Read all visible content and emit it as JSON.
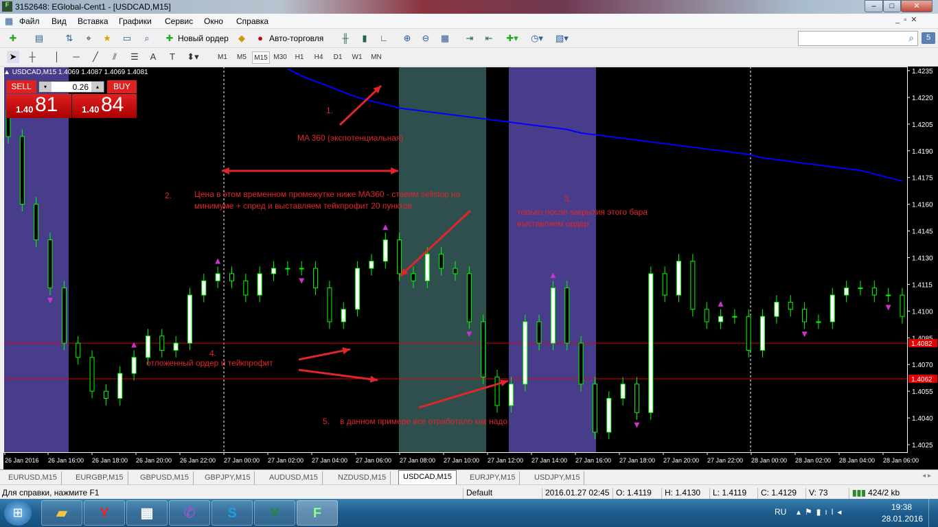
{
  "window": {
    "title": "3152648: EGlobal-Cent1 - [USDCAD,M15]",
    "controls": [
      "–",
      "□",
      "✕"
    ]
  },
  "menu": [
    "Файл",
    "Вид",
    "Вставка",
    "Графики",
    "Сервис",
    "Окно",
    "Справка"
  ],
  "toolbar": {
    "new_order": "Новый ордер",
    "auto_trading": "Авто-торговля",
    "notifications_count": "5",
    "search_placeholder": ""
  },
  "timeframes": [
    "M1",
    "M5",
    "M15",
    "M30",
    "H1",
    "H4",
    "D1",
    "W1",
    "MN"
  ],
  "active_timeframe": "M15",
  "chart": {
    "header": "USDCAD,M15  1.4069 1.4087 1.4069 1.4081",
    "one_click": {
      "sell": "SELL",
      "buy": "BUY",
      "lot": "0.26",
      "bid_prefix": "1.40",
      "bid_big": "81",
      "ask_prefix": "1.40",
      "ask_big": "84"
    },
    "annotations": {
      "n1": "1.",
      "ma_label": "MA 360 (экспотенциальная)",
      "n2": "2.",
      "text2": "Цена в этом временном промежутке ниже MA360 - ставим sellstop на минимуме + спред и выставляем тейкпрофит 20 пунктов",
      "n3": "3.",
      "text3": "только после закрытия этого бара выставляем ордер",
      "n4": "4.",
      "text4": "отложенный ордер и тейкпрофит",
      "n5": "5.",
      "text5": "в данном примере все отработало как надо"
    }
  },
  "chart_data": {
    "type": "candlestick",
    "symbol": "USDCAD",
    "timeframe": "M15",
    "ylim": [
      1.4018,
      1.424
    ],
    "y_ticks": [
      "1.4235",
      "1.4220",
      "1.4205",
      "1.4190",
      "1.4175",
      "1.4160",
      "1.4145",
      "1.4130",
      "1.4115",
      "1.4100",
      "1.4085",
      "1.4070",
      "1.4055",
      "1.4040",
      "1.4025"
    ],
    "x_ticks": [
      "26 Jan 2016",
      "26 Jan 16:00",
      "26 Jan 18:00",
      "26 Jan 20:00",
      "26 Jan 22:00",
      "27 Jan 00:00",
      "27 Jan 02:00",
      "27 Jan 04:00",
      "27 Jan 06:00",
      "27 Jan 08:00",
      "27 Jan 10:00",
      "27 Jan 12:00",
      "27 Jan 14:00",
      "27 Jan 16:00",
      "27 Jan 18:00",
      "27 Jan 20:00",
      "27 Jan 22:00",
      "28 Jan 00:00",
      "28 Jan 02:00",
      "28 Jan 04:00",
      "28 Jan 06:00"
    ],
    "closes": [
      1.4198,
      1.416,
      1.414,
      1.4113,
      1.4082,
      1.4074,
      1.4055,
      1.4051,
      1.4065,
      1.4074,
      1.4086,
      1.4078,
      1.4082,
      1.4109,
      1.4117,
      1.4121,
      1.4117,
      1.4109,
      1.4121,
      1.4124,
      1.4124,
      1.4124,
      1.4113,
      1.4094,
      1.4101,
      1.4124,
      1.4128,
      1.414,
      1.4121,
      1.4117,
      1.4132,
      1.4124,
      1.4121,
      1.4094,
      1.4063,
      1.4047,
      1.4059,
      1.4094,
      1.4082,
      1.4113,
      1.4082,
      1.4059,
      1.4032,
      1.4051,
      1.4059,
      1.4043,
      1.4121,
      1.4109,
      1.4128,
      1.4101,
      1.4094,
      1.4097,
      1.4097,
      1.4078,
      1.4097,
      1.4105,
      1.4101,
      1.4094,
      1.4094,
      1.4109,
      1.4113,
      1.4113,
      1.4109,
      1.4109,
      1.4097
    ],
    "ma360": [
      null,
      null,
      null,
      null,
      null,
      null,
      null,
      null,
      null,
      null,
      null,
      null,
      null,
      null,
      null,
      null,
      null,
      null,
      null,
      null,
      1.4236,
      1.4232,
      1.4229,
      1.4226,
      1.4223,
      1.422,
      1.4218,
      1.4216,
      1.4214,
      1.4213,
      1.4212,
      1.4211,
      1.421,
      1.4209,
      1.4208,
      1.4207,
      1.4206,
      1.4205,
      1.4204,
      1.4203,
      1.4202,
      1.42,
      1.4199,
      1.4198,
      1.4197,
      1.4196,
      1.4195,
      1.4194,
      1.4193,
      1.4192,
      1.4191,
      1.419,
      1.4189,
      1.4188,
      1.4186,
      1.4185,
      1.4184,
      1.4183,
      1.4182,
      1.4181,
      1.418,
      1.4179,
      1.4177,
      1.4175,
      1.4173
    ],
    "hlines": [
      {
        "price": "1.4082",
        "color": "#e00000"
      },
      {
        "price": "1.4062",
        "color": "#e00000"
      }
    ],
    "shaded_periods": [
      {
        "from": "26 Jan 14:00",
        "to": "26 Jan 15:45",
        "color": "#483d8b"
      },
      {
        "from": "27 Jan 08:00",
        "to": "27 Jan 12:00",
        "color": "#2f4f4f"
      },
      {
        "from": "27 Jan 13:00",
        "to": "27 Jan 17:00",
        "color": "#483d8b"
      }
    ],
    "colors": {
      "bg": "#000000",
      "bull": "#ffffff",
      "bear": "#000000",
      "wick": "#00ff00",
      "ma": "#0000ff",
      "fractal": "#cc33cc"
    }
  },
  "tabs": [
    "EURUSD,M15",
    "EURGBP,M15",
    "GBPUSD,M15",
    "GBPJPY,M15",
    "AUDUSD,M15",
    "NZDUSD,M15",
    "USDCAD,M15",
    "EURJPY,M15",
    "USDJPY,M15"
  ],
  "active_tab": "USDCAD,M15",
  "status": {
    "help": "Для справки, нажмите F1",
    "profile": "Default",
    "datetime": "2016.01.27 02:45",
    "open": "O: 1.4119",
    "high": "H: 1.4130",
    "low": "L: 1.4119",
    "close": "C: 1.4129",
    "volume": "V: 73",
    "traffic": "424/2 kb"
  },
  "taskbar": {
    "lang": "RU",
    "time": "19:38",
    "date": "28.01.2016"
  }
}
